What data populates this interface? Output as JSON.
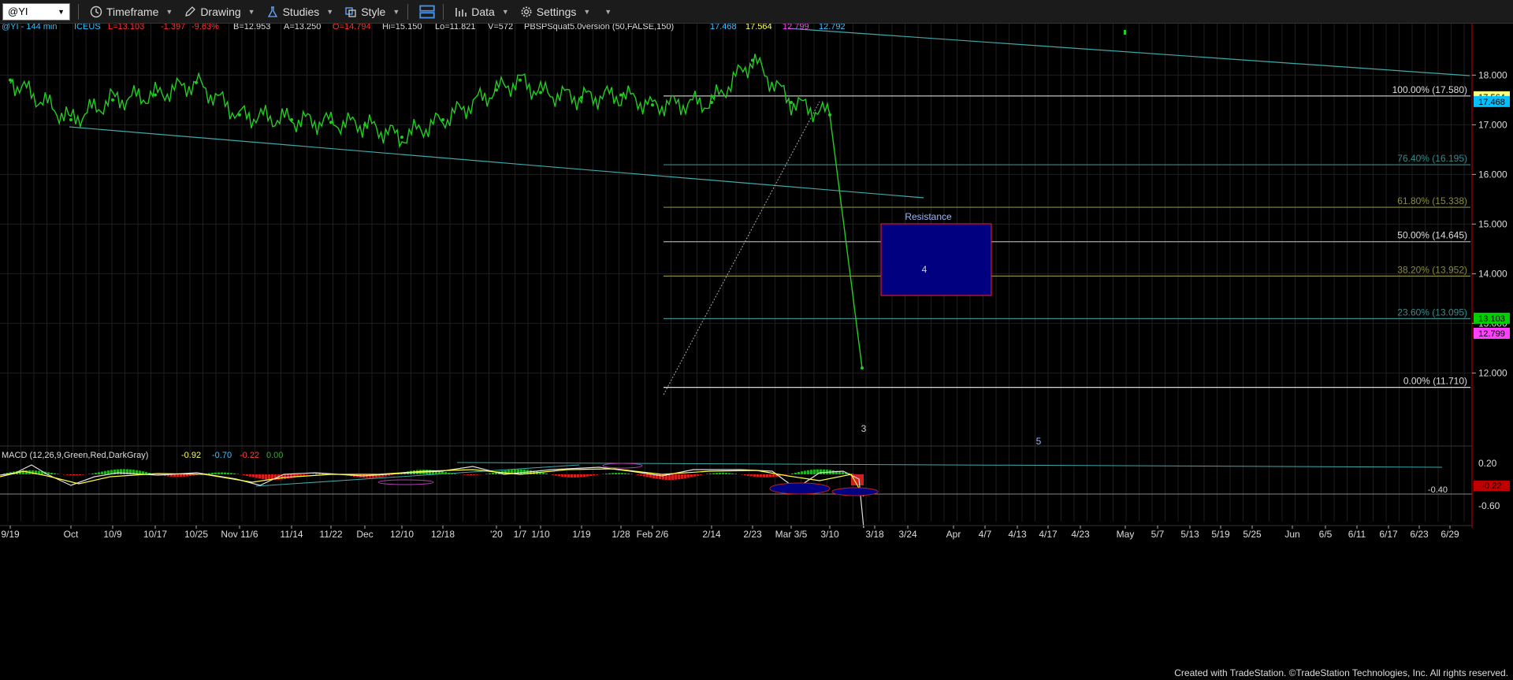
{
  "toolbar": {
    "symbol": "@YI",
    "timeframe": "Timeframe",
    "drawing": "Drawing",
    "studies": "Studies",
    "style": "Style",
    "data": "Data",
    "settings": "Settings"
  },
  "header": {
    "instrument": "@YI - 144 min",
    "exchange": "ICEUS",
    "last": "L=13.103",
    "change": "-1.397",
    "pct": "-9.63%",
    "bid": "B=12.953",
    "ask": "A=13.250",
    "open": "O=14.794",
    "high": "Hi=15.150",
    "low": "Lo=11.821",
    "volume": "V=572",
    "study": "PBSPSquat5.0version (50,FALSE,150)",
    "study_vals": [
      "17.468",
      "17.564",
      "12.799",
      "12.792"
    ],
    "colors": {
      "label": "#30c0ff",
      "last": "#ff3030",
      "open": "#ff3030",
      "val1": "#40c0ff",
      "val2": "#ffff60",
      "val3": "#ff40ff",
      "val4": "#40c0ff"
    }
  },
  "fib_levels": [
    {
      "label": "100.00% (17.580)",
      "value": 17.58,
      "color": "#d8d8d8"
    },
    {
      "label": "76.40% (16.195)",
      "value": 16.195,
      "color": "#3a8a8a"
    },
    {
      "label": "61.80% (15.338)",
      "value": 15.338,
      "color": "#8a8a40"
    },
    {
      "label": "50.00% (14.645)",
      "value": 14.645,
      "color": "#a8a8a8"
    },
    {
      "label": "38.20% (13.952)",
      "value": 13.952,
      "color": "#8a8a40"
    },
    {
      "label": "23.60% (13.095)",
      "value": 13.095,
      "color": "#3a8a8a"
    },
    {
      "label": "0.00% (11.710)",
      "value": 11.71,
      "color": "#d8d8d8"
    }
  ],
  "annotations": {
    "resistance": "Resistance",
    "wave3": "3",
    "wave4": "4",
    "wave5": "5"
  },
  "price_badges": [
    {
      "text": "17.564",
      "value": 17.564,
      "bg": "#ffff80",
      "fg": "#000"
    },
    {
      "text": "17.468",
      "value": 17.468,
      "bg": "#00c0ff",
      "fg": "#000"
    },
    {
      "text": "13.103",
      "value": 13.103,
      "bg": "#00d000",
      "fg": "#000"
    },
    {
      "text": "12.799",
      "value": 12.799,
      "bg": "#ff40ff",
      "fg": "#000"
    }
  ],
  "macd": {
    "title": "MACD (12,26,9,Green,Red,DarkGray)",
    "values": [
      "-0.92",
      "-0.70",
      "-0.22",
      "0.00"
    ],
    "value_colors": [
      "#ffff60",
      "#40c0ff",
      "#ff4040",
      "#40a040"
    ],
    "axis_ticks": [
      "0.20",
      "-0.40",
      "-0.60"
    ],
    "badge": "-0.22",
    "line_label": "-0.40"
  },
  "footer": "Created with TradeStation. ©TradeStation Technologies, Inc. All rights reserved.",
  "chart_data": {
    "type": "line",
    "title": "@YI - 144 min",
    "price_axis_ticks": [
      "18.000",
      "17.000",
      "16.000",
      "15.000",
      "14.000",
      "13.000",
      "12.000"
    ],
    "ylim": [
      11.45,
      18.45
    ],
    "x_tick_labels": [
      "9/19",
      "Oct",
      "10/9",
      "10/17",
      "10/25",
      "Nov 11/6",
      "11/14",
      "11/22",
      "Dec",
      "12/10",
      "12/18",
      "'20",
      "1/7",
      "1/10",
      "1/19",
      "1/28",
      "Feb 2/6",
      "2/14",
      "2/23",
      "Mar 3/5",
      "3/10",
      "3/18",
      "3/24",
      "Apr",
      "4/7",
      "4/13",
      "4/17",
      "4/23",
      "May",
      "5/7",
      "5/13",
      "5/19",
      "5/25",
      "Jun",
      "6/5",
      "6/11",
      "6/17",
      "6/23",
      "6/29"
    ],
    "series": [
      {
        "name": "",
        "x": [
          "9/19",
          "Oct",
          "10/9",
          "10/17",
          "10/25",
          "Nov 11/6",
          "11/14",
          "11/22",
          "Dec",
          "12/10",
          "12/18",
          "'20",
          "1/7",
          "1/10",
          "1/19",
          "1/28",
          "Feb 2/6",
          "2/14",
          "2/23",
          "Mar 3/5",
          "3/10",
          "3/18"
        ],
        "values": [
          17.9,
          17.1,
          17.5,
          17.6,
          17.85,
          17.2,
          17.1,
          17.05,
          17.0,
          16.75,
          17.1,
          17.7,
          17.9,
          17.65,
          17.55,
          17.6,
          17.4,
          17.45,
          18.3,
          17.45,
          17.2,
          12.1
        ]
      }
    ],
    "resistance_zone": [
      13.952,
      15.338
    ],
    "grid": true,
    "legend": "none"
  }
}
